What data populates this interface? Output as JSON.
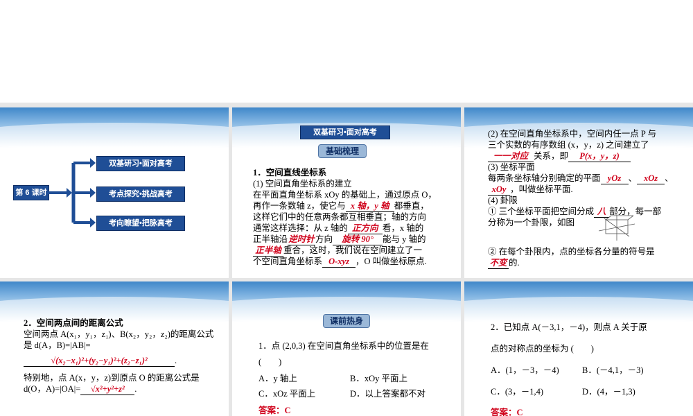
{
  "s1": {
    "lesson": "第 6 课时",
    "items": [
      "双基研习•面对高考",
      "考点探究•挑战高考",
      "考向瞭望•把脉高考"
    ]
  },
  "s2": {
    "header": "双基研习•面对高考",
    "badge": "基础梳理",
    "l1": "1．空间直线坐标系",
    "l2": "(1) 空间直角坐标系的建立",
    "l3": "在平面直角坐标系 xOy 的基础上，通过原点 O，",
    "l4a": "再作一条数轴 z，使它与",
    "l4b": "x 轴，y 轴",
    "l4c": "都垂直，",
    "l5": "这样它们中的任意两条都互相垂直；轴的方向",
    "l6a": "通常这样选择：从 z 轴的",
    "l6b": "正方向",
    "l6c": "看，x 轴的",
    "l7a": "正半轴沿",
    "l7b": "逆时针",
    "l7c": "方向",
    "l7d": "旋转 90°",
    "l7e": "能与 y 轴的",
    "l8a": "正半轴",
    "l8b": "重合，这时，我们说在空间建立了一",
    "l9a": "个空间直角坐标系",
    "l9b": "O-xyz",
    "l9c": "，O 叫做坐标原点."
  },
  "s3": {
    "l1": "(2) 在空间直角坐标系中，空间内任一点 P 与",
    "l2": "三个实数的有序数组 (x，y，z) 之间建立了",
    "l3a": "一一对应",
    "l3b": "关系，即",
    "l3c": "P(x，y，z)",
    "l4": "(3) 坐标平面",
    "l5a": "每两条坐标轴分别确定的平面",
    "l5b": "yOz",
    "l5c": "、",
    "l5d": "xOz",
    "l5e": "、",
    "l6a": "xOy",
    "l6b": "，叫做坐标平面.",
    "l7": "(4) 卦限",
    "l8a": "① 三个坐标平面把空间分成",
    "l8b": "八",
    "l8c": "部分，每一部",
    "l9": "分称为一个卦限，如图",
    "l10": "② 在每个卦限内，点的坐标各分量的符号是",
    "l11a": "不变",
    "l11b": "的."
  },
  "s4": {
    "l1": "2．空间两点间的距离公式",
    "l2": "空间两点 A(x₁，y₁，z₁)、B(x₂，y₂，z₂)的距离公式",
    "l3": "是 d(A，B)=|AB|=",
    "formula": "√(x₂−x₁)²+(y₂−y₁)²+(z₂−z₁)²",
    "l4": "特别地，点 A(x，y，z)到原点 O 的距离公式是",
    "l5a": "d(O，A)=|OA|=",
    "l5b": "√x²+y²+z²",
    "l5c": "."
  },
  "s5": {
    "badge": "课前热身",
    "q": "1．点 (2,0,3) 在空间直角坐标系中的位置是在",
    "paren": "(　　)",
    "a": "A．y 轴上",
    "b": "B．xOy 平面上",
    "c": "C．xOz 平面上",
    "d": "D．以上答案都不对",
    "ans_label": "答案：",
    "ans": "C"
  },
  "s6": {
    "q1": "2．已知点 A(－3,1，－4)，则点 A 关于原",
    "q2": "点的对称点的坐标为 (　　)",
    "a": "A．(1，－3，－4)",
    "b": "B．(－4,1，－3)",
    "c": "C．(3，－1,4)",
    "d": "D．(4，－1,3)",
    "ans_label": "答案：",
    "ans": "C"
  }
}
